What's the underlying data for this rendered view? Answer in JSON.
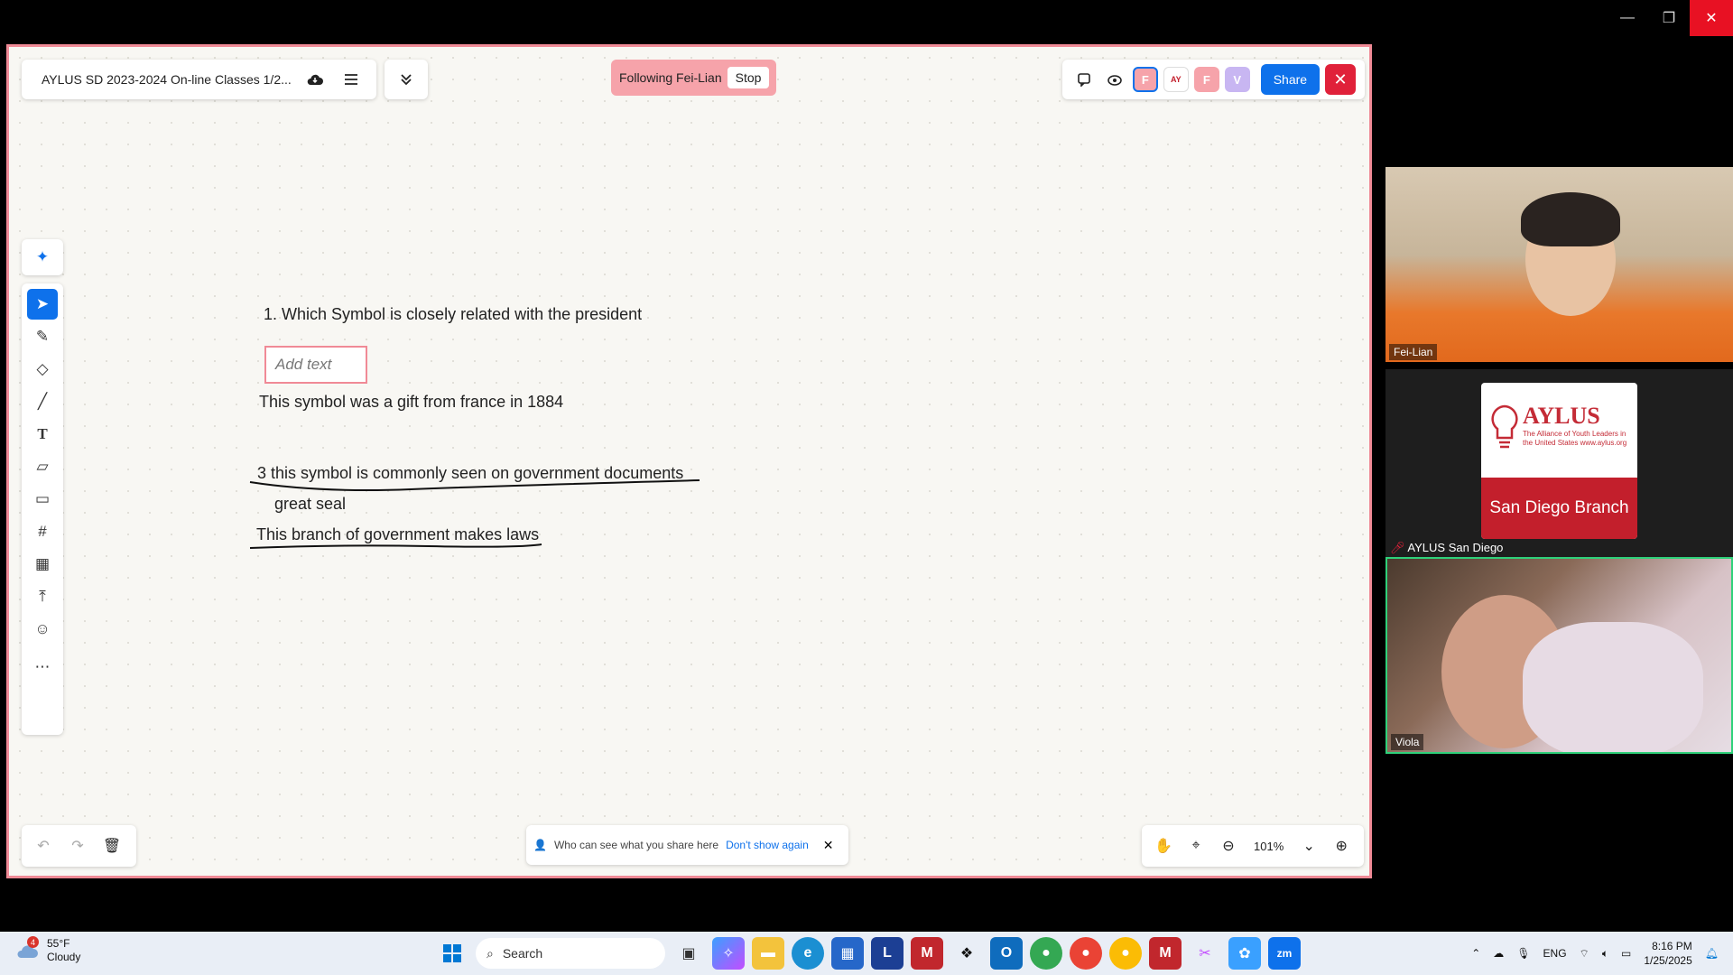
{
  "window": {
    "min": "—",
    "max": "❐",
    "close": "✕"
  },
  "doc": {
    "title": "AYLUS SD 2023-2024 On-line Classes 1/2..."
  },
  "follow": {
    "text": "Following Fei-Lian",
    "stop": "Stop"
  },
  "toolbar": {
    "avatars": [
      {
        "letter": "F",
        "color": "#f6a3aa"
      },
      {
        "letter": "F",
        "color": "#f6a3aa"
      },
      {
        "letter": "V",
        "color": "#c8b6f2"
      }
    ],
    "share": "Share",
    "close": "✕"
  },
  "board": {
    "q1": "1. Which Symbol is closely related with the president",
    "add_text": "Add text",
    "line2": "This symbol was a gift from france in 1884",
    "line3": "3 this symbol is commonly seen on government documents",
    "line4": "great seal",
    "line5": "This branch of government makes laws"
  },
  "notice": {
    "text": "Who can see what you share here",
    "link": "Don't show again"
  },
  "zoom": {
    "value": "101%"
  },
  "participants": {
    "p1": "Fei-Lian",
    "p2": "AYLUS San Diego",
    "p3": "Viola",
    "aylus_logo": "AYLUS",
    "aylus_tag": "The Alliance of Youth Leaders in the United States www.aylus.org",
    "aylus_branch": "San Diego Branch"
  },
  "taskbar": {
    "temp": "55°F",
    "condition": "Cloudy",
    "badge": "4",
    "search": "Search",
    "lang": "ENG",
    "time": "8:16 PM",
    "date": "1/25/2025"
  }
}
